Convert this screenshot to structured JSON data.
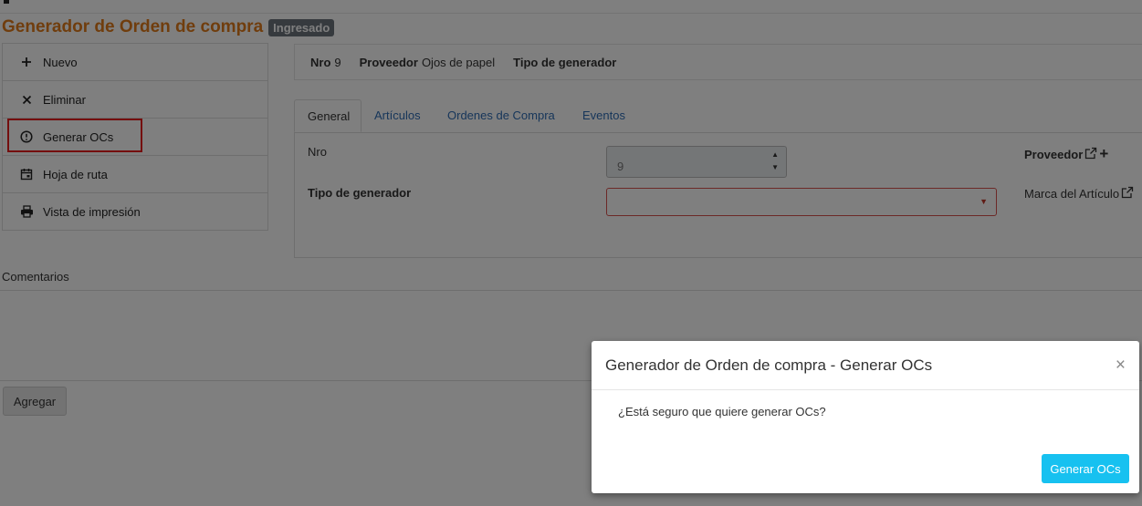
{
  "header": {
    "title": "Generador de Orden de compra",
    "status_badge": "Ingresado"
  },
  "actions": [
    {
      "label": "Nuevo",
      "icon": "plus-icon"
    },
    {
      "label": "Eliminar",
      "icon": "x-icon"
    },
    {
      "label": "Generar OCs",
      "icon": "alert-circle-icon"
    },
    {
      "label": "Hoja de ruta",
      "icon": "calendar-icon"
    },
    {
      "label": "Vista de impresión",
      "icon": "printer-icon"
    }
  ],
  "infobar": {
    "nro_label": "Nro",
    "nro_value": "9",
    "proveedor_label": "Proveedor",
    "proveedor_value": "Ojos de papel",
    "tipo_label": "Tipo de generador"
  },
  "tabs": [
    {
      "label": "General",
      "active": true
    },
    {
      "label": "Artículos"
    },
    {
      "label": "Ordenes de Compra"
    },
    {
      "label": "Eventos"
    }
  ],
  "form": {
    "nro_label": "Nro",
    "nro_value": "9",
    "tipo_label": "Tipo de generador",
    "tipo_value": "",
    "proveedor_label": "Proveedor",
    "marca_label": "Marca del Artículo"
  },
  "comments": {
    "label": "Comentarios",
    "add_button": "Agregar"
  },
  "modal": {
    "title": "Generador de Orden de compra - Generar OCs",
    "close": "×",
    "body": "¿Está seguro que quiere generar OCs?",
    "confirm_button": "Generar OCs"
  },
  "colors": {
    "title": "#e07b1a",
    "badge": "#6c757d",
    "tab_link": "#2f6db5",
    "primary_button": "#17c1f0",
    "highlight": "#e81c1c",
    "invalid_border": "#d9534f"
  }
}
